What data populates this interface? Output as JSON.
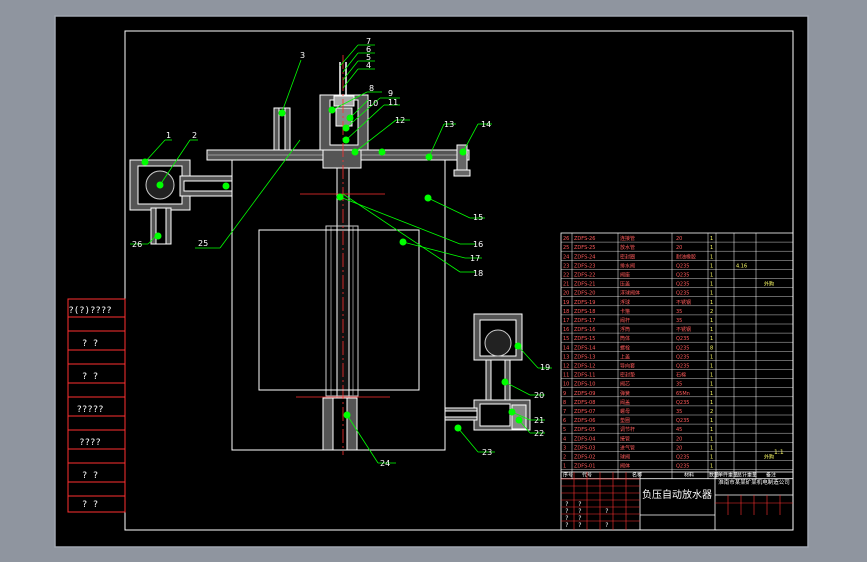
{
  "drawing": {
    "title": "负压自动放水器",
    "company": "淮南市某某矿某机电制造公司",
    "scale_note": "1:1"
  },
  "side_panel": {
    "cells": [
      "?(?)????",
      "?  ?",
      "?  ?",
      "?????",
      "????",
      "?  ?",
      "?  ?"
    ]
  },
  "callouts": {
    "top_stack": [
      "7",
      "6",
      "5",
      "4"
    ],
    "n1": "1",
    "n2": "2",
    "n3": "3",
    "n8": "8",
    "n9": "9",
    "n10": "10",
    "n11": "11",
    "n12": "12",
    "n13": "13",
    "n14": "14",
    "n15": "15",
    "n16": "16",
    "n17": "17",
    "n18": "18",
    "n19": "19",
    "n20": "20",
    "n21": "21",
    "n22": "22",
    "n23": "23",
    "n24": "24",
    "n25": "25",
    "n26": "26"
  },
  "bom": {
    "header": [
      "序号",
      "代号",
      "名称",
      "材料",
      "数量",
      "单件重量",
      "总计重量",
      "备注"
    ],
    "rows": [
      {
        "no": "26",
        "code": "ZDFS-26",
        "name": "连接管",
        "mat": "20",
        "qty": "1"
      },
      {
        "no": "25",
        "code": "ZDFS-25",
        "name": "放水管",
        "mat": "20",
        "qty": "1"
      },
      {
        "no": "24",
        "code": "ZDFS-24",
        "name": "密封圈",
        "mat": "耐油橡胶",
        "qty": "1"
      },
      {
        "no": "23",
        "code": "ZDFS-23",
        "name": "排水阀",
        "mat": "Q235",
        "qty": "1",
        "extra": "4.16"
      },
      {
        "no": "22",
        "code": "ZDFS-22",
        "name": "阀座",
        "mat": "Q235",
        "qty": "1"
      },
      {
        "no": "21",
        "code": "ZDFS-21",
        "name": "压盖",
        "mat": "Q235",
        "qty": "1",
        "note": "外购"
      },
      {
        "no": "20",
        "code": "ZDFS-20",
        "name": "浮球阀体",
        "mat": "Q235",
        "qty": "1"
      },
      {
        "no": "19",
        "code": "ZDFS-19",
        "name": "浮球",
        "mat": "不锈钢",
        "qty": "1"
      },
      {
        "no": "18",
        "code": "ZDFS-18",
        "name": "卡箍",
        "mat": "35",
        "qty": "2"
      },
      {
        "no": "17",
        "code": "ZDFS-17",
        "name": "阀杆",
        "mat": "35",
        "qty": "1"
      },
      {
        "no": "16",
        "code": "ZDFS-16",
        "name": "浮筒",
        "mat": "不锈钢",
        "qty": "1"
      },
      {
        "no": "15",
        "code": "ZDFS-15",
        "name": "筒体",
        "mat": "Q235",
        "qty": "1"
      },
      {
        "no": "14",
        "code": "ZDFS-14",
        "name": "螺栓",
        "mat": "Q235",
        "qty": "8"
      },
      {
        "no": "13",
        "code": "ZDFS-13",
        "name": "上盖",
        "mat": "Q235",
        "qty": "1"
      },
      {
        "no": "12",
        "code": "ZDFS-12",
        "name": "导向套",
        "mat": "Q235",
        "qty": "1"
      },
      {
        "no": "11",
        "code": "ZDFS-11",
        "name": "密封垫",
        "mat": "石棉",
        "qty": "1"
      },
      {
        "no": "10",
        "code": "ZDFS-10",
        "name": "阀芯",
        "mat": "35",
        "qty": "1"
      },
      {
        "no": "9",
        "code": "ZDFS-09",
        "name": "弹簧",
        "mat": "65Mn",
        "qty": "1"
      },
      {
        "no": "8",
        "code": "ZDFS-08",
        "name": "阀盖",
        "mat": "Q235",
        "qty": "1"
      },
      {
        "no": "7",
        "code": "ZDFS-07",
        "name": "螺母",
        "mat": "35",
        "qty": "2"
      },
      {
        "no": "6",
        "code": "ZDFS-06",
        "name": "垫圈",
        "mat": "Q235",
        "qty": "1"
      },
      {
        "no": "5",
        "code": "ZDFS-05",
        "name": "调节杆",
        "mat": "45",
        "qty": "1"
      },
      {
        "no": "4",
        "code": "ZDFS-04",
        "name": "接管",
        "mat": "20",
        "qty": "1"
      },
      {
        "no": "3",
        "code": "ZDFS-03",
        "name": "进气管",
        "mat": "20",
        "qty": "1"
      },
      {
        "no": "2",
        "code": "ZDFS-02",
        "name": "球阀",
        "mat": "Q235",
        "qty": "1",
        "note": "外购"
      },
      {
        "no": "1",
        "code": "ZDFS-01",
        "name": "阀体",
        "mat": "Q235",
        "qty": "1"
      }
    ]
  },
  "title_block_marks": [
    "?",
    "?",
    "?",
    "?",
    "?",
    "?",
    "?",
    "?",
    "?",
    "?"
  ],
  "colors": {
    "paper": "#000000",
    "outer_bg": "#8f959f",
    "line": "#ffffff",
    "callout": "#00ff00",
    "part_edge": "#c8c8c8",
    "table_text": "#ff5a5a",
    "table_text2": "#ffff66"
  }
}
